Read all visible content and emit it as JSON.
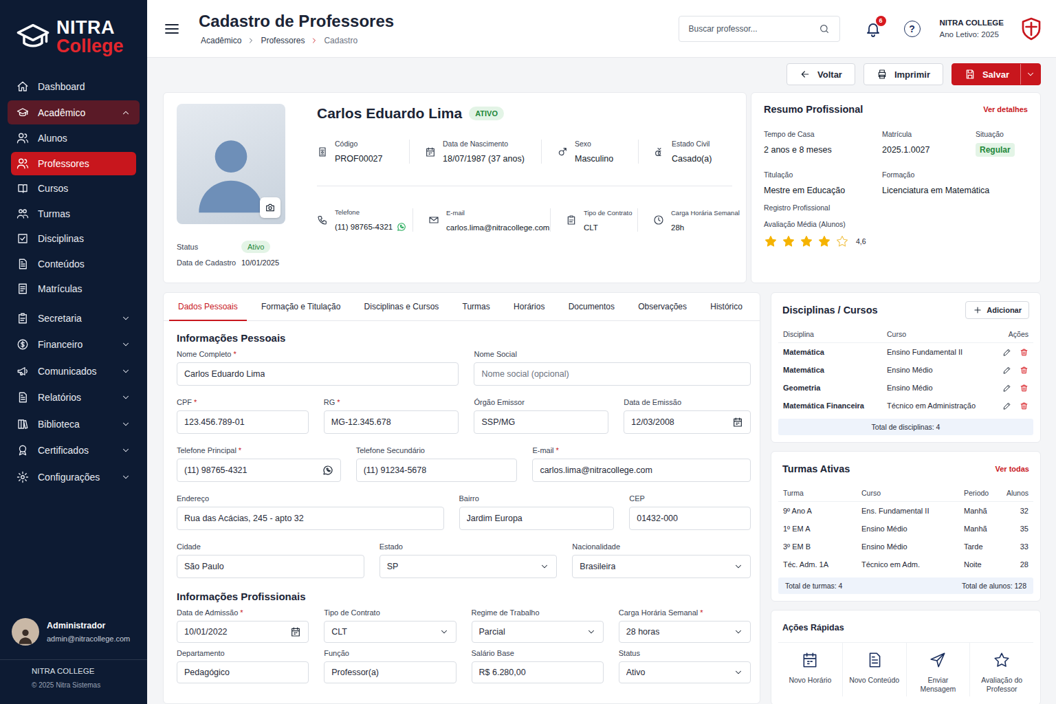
{
  "brand": {
    "name": "NITRA",
    "sub": "College"
  },
  "sidebar": {
    "items": [
      {
        "label": "Dashboard",
        "kind": "item",
        "selected": false,
        "expanded": false
      },
      {
        "label": "Acadêmico",
        "kind": "group",
        "selected": true,
        "expanded": true
      },
      {
        "label": "Alunos",
        "kind": "sub",
        "selected": false,
        "expanded": false
      },
      {
        "label": "Professores",
        "kind": "sub",
        "selected": true,
        "expanded": false
      },
      {
        "label": "Cursos",
        "kind": "sub",
        "selected": false,
        "expanded": false
      },
      {
        "label": "Turmas",
        "kind": "sub",
        "selected": false,
        "expanded": false
      },
      {
        "label": "Disciplinas",
        "kind": "sub",
        "selected": false,
        "expanded": false
      },
      {
        "label": "Conteúdos",
        "kind": "sub",
        "selected": false,
        "expanded": false
      },
      {
        "label": "Matrículas",
        "kind": "sub",
        "selected": false,
        "expanded": false
      },
      {
        "label": "Secretaria",
        "kind": "group",
        "selected": false,
        "expanded": false
      },
      {
        "label": "Financeiro",
        "kind": "group",
        "selected": false,
        "expanded": false
      },
      {
        "label": "Comunicados",
        "kind": "group",
        "selected": false,
        "expanded": false
      },
      {
        "label": "Relatórios",
        "kind": "group",
        "selected": false,
        "expanded": false
      },
      {
        "label": "Biblioteca",
        "kind": "group",
        "selected": false,
        "expanded": false
      },
      {
        "label": "Certificados",
        "kind": "group",
        "selected": false,
        "expanded": false
      },
      {
        "label": "Configurações",
        "kind": "group",
        "selected": false,
        "expanded": false
      }
    ],
    "user": {
      "name": "Administrador",
      "email": "admin@nitracollege.com"
    },
    "footer": {
      "org": "NITRA COLLEGE",
      "copyright": "© 2025 Nitra Sistemas"
    }
  },
  "header": {
    "title": "Cadastro de Professores",
    "breadcrumb": [
      "Acadêmico",
      "Professores",
      "Cadastro"
    ],
    "search_placeholder": "Buscar professor...",
    "notifications": "6",
    "help": "?",
    "org": "NITRA COLLEGE",
    "year": "Ano Letivo: 2025"
  },
  "actions": [
    {
      "label": "Voltar",
      "kind": "back"
    },
    {
      "label": "Imprimir",
      "kind": "print"
    },
    {
      "label": "Salvar",
      "kind": "save"
    }
  ],
  "profile": {
    "name": "Carlos Eduardo Lima",
    "badge": "ATIVO",
    "status_label": "Status",
    "status": "Ativo",
    "registered_label": "Data de Cadastro",
    "registered": "10/01/2025",
    "info": [
      [
        {
          "label": "Código",
          "value": "PROF00027",
          "kind": "text"
        },
        {
          "label": "Data de Nascimento",
          "value": "18/07/1987 (37 anos)",
          "kind": "text"
        },
        {
          "label": "Sexo",
          "value": "Masculino",
          "kind": "text"
        },
        {
          "label": "Estado Civil",
          "value": "Casado(a)",
          "kind": "text"
        }
      ],
      [
        {
          "label": "Telefone",
          "value": "(11) 98765-4321",
          "kind": "whatsapp"
        },
        {
          "label": "E-mail",
          "value": "carlos.lima@nitracollege.com",
          "kind": "text"
        },
        {
          "label": "Tipo de Contrato",
          "value": "CLT",
          "kind": "text"
        },
        {
          "label": "Carga Horária Semanal",
          "value": "28h",
          "kind": "text"
        }
      ]
    ]
  },
  "summary": {
    "title": "Resumo Profissional",
    "link": "Ver detalhes",
    "rows": [
      [
        {
          "label": "Tempo de Casa",
          "value": "2 anos e 8 meses",
          "kind": "text"
        },
        {
          "label": "Matrícula",
          "value": "2025.1.0027",
          "kind": "text"
        },
        {
          "label": "Situação",
          "value": "Regular",
          "kind": "badge"
        }
      ],
      [
        {
          "label": "Titulação",
          "value": "Mestre em Educação",
          "kind": "text"
        },
        {
          "label": "Formação",
          "value": "Licenciatura em Matemática",
          "kind": "text"
        }
      ]
    ],
    "registry_label": "Registro Profissional",
    "rating_label": "Avaliação Média (Alunos)",
    "stars": 4,
    "rating": "4,6"
  },
  "tabs": [
    {
      "label": "Dados Pessoais",
      "selected": true
    },
    {
      "label": "Formação e Titulação",
      "selected": false
    },
    {
      "label": "Disciplinas e Cursos",
      "selected": false
    },
    {
      "label": "Turmas",
      "selected": false
    },
    {
      "label": "Horários",
      "selected": false
    },
    {
      "label": "Documentos",
      "selected": false
    },
    {
      "label": "Observações",
      "selected": false
    },
    {
      "label": "Histórico",
      "selected": false
    }
  ],
  "form": {
    "required_mark": "*",
    "sections": [
      {
        "title": "Informações Pessoais",
        "rows": [
          [
            {
              "label": "Nome Completo",
              "value": "Carlos Eduardo Lima",
              "required": true,
              "kind": "text"
            },
            {
              "label": "Nome Social",
              "value": "",
              "placeholder": "Nome social (opcional)",
              "required": false,
              "kind": "text"
            }
          ],
          [
            {
              "label": "CPF",
              "value": "123.456.789-01",
              "required": true,
              "kind": "text"
            },
            {
              "label": "RG",
              "value": "MG-12.345.678",
              "required": true,
              "kind": "text"
            },
            {
              "label": "Órgão Emissor",
              "value": "SSP/MG",
              "required": false,
              "kind": "text"
            },
            {
              "label": "Data de Emissão",
              "value": "12/03/2008",
              "required": false,
              "kind": "date"
            }
          ],
          [
            {
              "label": "Telefone Principal",
              "value": "(11) 98765-4321",
              "required": true,
              "kind": "whatsapp"
            },
            {
              "label": "Telefone Secundário",
              "value": "(11) 91234-5678",
              "required": false,
              "kind": "text"
            },
            {
              "label": "E-mail",
              "value": "carlos.lima@nitracollege.com",
              "required": true,
              "kind": "text"
            }
          ],
          [
            {
              "label": "Endereço",
              "value": "Rua das Acácias, 245 - apto 32",
              "required": false,
              "kind": "text"
            },
            {
              "label": "Bairro",
              "value": "Jardim Europa",
              "required": false,
              "kind": "text"
            },
            {
              "label": "CEP",
              "value": "01432-000",
              "required": false,
              "kind": "text"
            }
          ],
          [
            {
              "label": "Cidade",
              "value": "São Paulo",
              "required": false,
              "kind": "text"
            },
            {
              "label": "Estado",
              "value": "SP",
              "required": false,
              "kind": "select"
            },
            {
              "label": "Nacionalidade",
              "value": "Brasileira",
              "required": false,
              "kind": "select"
            }
          ]
        ]
      },
      {
        "title": "Informações Profissionais",
        "rows": [
          [
            {
              "label": "Data de Admissão",
              "value": "10/01/2022",
              "required": true,
              "kind": "date"
            },
            {
              "label": "Tipo de Contrato",
              "value": "CLT",
              "required": false,
              "kind": "select"
            },
            {
              "label": "Regime de Trabalho",
              "value": "Parcial",
              "required": false,
              "kind": "select"
            },
            {
              "label": "Carga Horária Semanal",
              "value": "28 horas",
              "required": true,
              "kind": "select"
            }
          ],
          [
            {
              "label": "Departamento",
              "value": "Pedagógico",
              "required": false,
              "kind": "text"
            },
            {
              "label": "Função",
              "value": "Professor(a)",
              "required": false,
              "kind": "text"
            },
            {
              "label": "Salário Base",
              "value": "R$ 6.280,00",
              "required": false,
              "kind": "text"
            },
            {
              "label": "Status",
              "value": "Ativo",
              "required": false,
              "kind": "select"
            }
          ]
        ]
      }
    ]
  },
  "disciplines": {
    "title": "Disciplinas / Cursos",
    "add": "Adicionar",
    "columns": [
      "Disciplina",
      "Curso",
      "Ações"
    ],
    "rows": [
      {
        "discipline": "Matemática",
        "course": "Ensino Fundamental II"
      },
      {
        "discipline": "Matemática",
        "course": "Ensino Médio"
      },
      {
        "discipline": "Geometria",
        "course": "Ensino Médio"
      },
      {
        "discipline": "Matemática Financeira",
        "course": "Técnico em Administração"
      }
    ],
    "total": "Total de disciplinas: 4"
  },
  "classes": {
    "title": "Turmas Ativas",
    "link": "Ver todas",
    "columns": [
      "Turma",
      "Curso",
      "Periodo",
      "Alunos"
    ],
    "rows": [
      {
        "class": "9º Ano A",
        "course": "Ens. Fundamental II",
        "period": "Manhã",
        "students": "32"
      },
      {
        "class": "1º EM A",
        "course": "Ensino Médio",
        "period": "Manhã",
        "students": "35"
      },
      {
        "class": "3º EM B",
        "course": "Ensino Médio",
        "period": "Tarde",
        "students": "33"
      },
      {
        "class": "Téc. Adm. 1A",
        "course": "Técnico em Adm.",
        "period": "Noite",
        "students": "28"
      }
    ],
    "total_classes": "Total de turmas: 4",
    "total_students": "Total de alunos: 128"
  },
  "quick": {
    "title": "Ações Rápidas",
    "items": [
      "Novo Horário",
      "Novo Conteúdo",
      "Enviar Mensagem",
      "Avaliação do Professor"
    ]
  }
}
